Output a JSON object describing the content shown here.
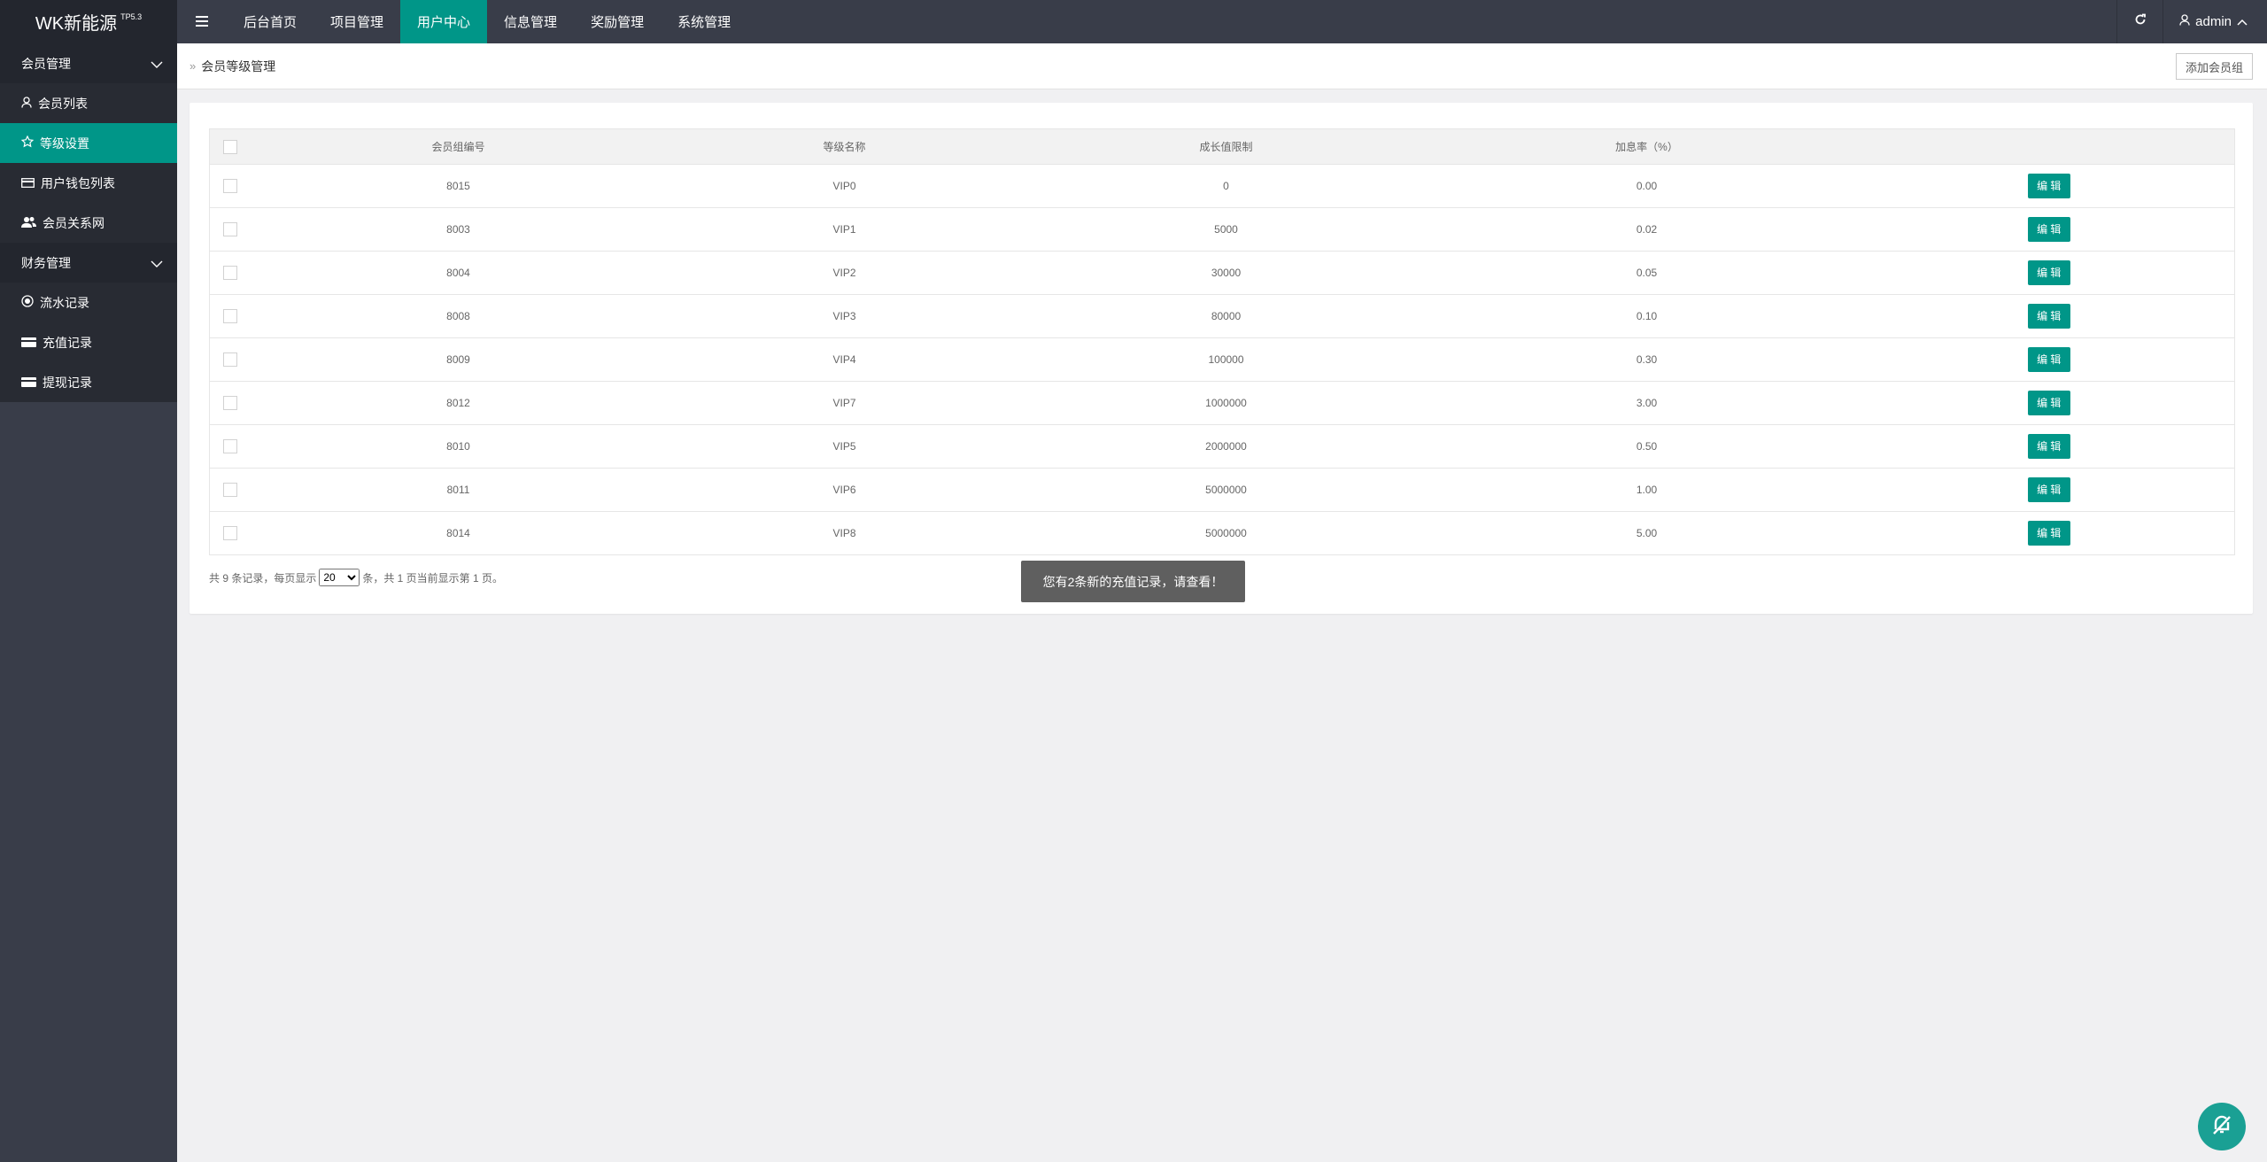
{
  "brand": {
    "name": "WK新能源",
    "version": "TP5.3"
  },
  "topnav": {
    "menu_icon": "hamburger-icon",
    "items": [
      {
        "label": "后台首页",
        "active": false
      },
      {
        "label": "项目管理",
        "active": false
      },
      {
        "label": "用户中心",
        "active": true
      },
      {
        "label": "信息管理",
        "active": false
      },
      {
        "label": "奖励管理",
        "active": false
      },
      {
        "label": "系统管理",
        "active": false
      }
    ],
    "user": "admin"
  },
  "sidebar": {
    "groups": [
      {
        "label": "会员管理",
        "items": [
          {
            "label": "会员列表",
            "icon": "user-icon"
          },
          {
            "label": "等级设置",
            "icon": "star-icon",
            "active": true
          },
          {
            "label": "用户钱包列表",
            "icon": "card-icon"
          },
          {
            "label": "会员关系网",
            "icon": "users-icon"
          }
        ]
      },
      {
        "label": "财务管理",
        "items": [
          {
            "label": "流水记录",
            "icon": "circle-icon"
          },
          {
            "label": "充值记录",
            "icon": "card-icon"
          },
          {
            "label": "提现记录",
            "icon": "card-icon"
          }
        ]
      }
    ]
  },
  "breadcrumb": {
    "sep": "»",
    "title": "会员等级管理"
  },
  "add_button": "添加会员组",
  "table": {
    "headers": [
      "会员组编号",
      "等级名称",
      "成长值限制",
      "加息率（%）"
    ],
    "edit_label": "编 辑",
    "rows": [
      [
        "8015",
        "VIP0",
        "0",
        "0.00"
      ],
      [
        "8003",
        "VIP1",
        "5000",
        "0.02"
      ],
      [
        "8004",
        "VIP2",
        "30000",
        "0.05"
      ],
      [
        "8008",
        "VIP3",
        "80000",
        "0.10"
      ],
      [
        "8009",
        "VIP4",
        "100000",
        "0.30"
      ],
      [
        "8012",
        "VIP7",
        "1000000",
        "3.00"
      ],
      [
        "8010",
        "VIP5",
        "2000000",
        "0.50"
      ],
      [
        "8011",
        "VIP6",
        "5000000",
        "1.00"
      ],
      [
        "8014",
        "VIP8",
        "5000000",
        "5.00"
      ]
    ]
  },
  "pager": {
    "prefix": "共 9 条记录，每页显示",
    "page_size": "20",
    "suffix": "条，共 1 页当前显示第 1 页。"
  },
  "toast": "您有2条新的充值记录，请查看！",
  "colors": {
    "accent": "#009688",
    "topbar": "#393d49",
    "sidebar_dark": "#23262e"
  }
}
